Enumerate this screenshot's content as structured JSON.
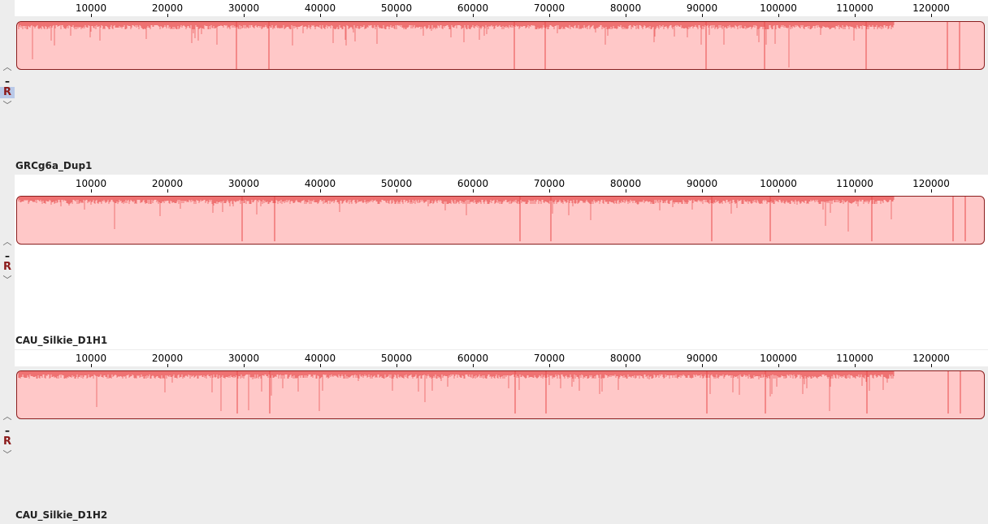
{
  "ruler": {
    "ticks": [
      "10000",
      "20000",
      "30000",
      "40000",
      "50000",
      "60000",
      "70000",
      "80000",
      "90000",
      "100000",
      "110000",
      "120000"
    ]
  },
  "tracks": [
    {
      "name": "GRCg6a_Dup1",
      "controls": {
        "up": "^",
        "minus": "–",
        "r": "R",
        "down": "v"
      },
      "r_active": true,
      "background": "#ededed"
    },
    {
      "name": "CAU_Silkie_D1H1",
      "controls": {
        "up": "^",
        "minus": "–",
        "r": "R",
        "down": "v"
      },
      "r_active": false,
      "background": "#ffffff"
    },
    {
      "name": "CAU_Silkie_D1H2",
      "controls": {
        "up": "^",
        "minus": "–",
        "r": "R",
        "down": "v"
      },
      "r_active": false,
      "background": "#ededed"
    }
  ],
  "colors": {
    "block_fill": "#ffc8c8",
    "block_border": "#8a1f1f",
    "similarity_line": "#e84a4a"
  }
}
